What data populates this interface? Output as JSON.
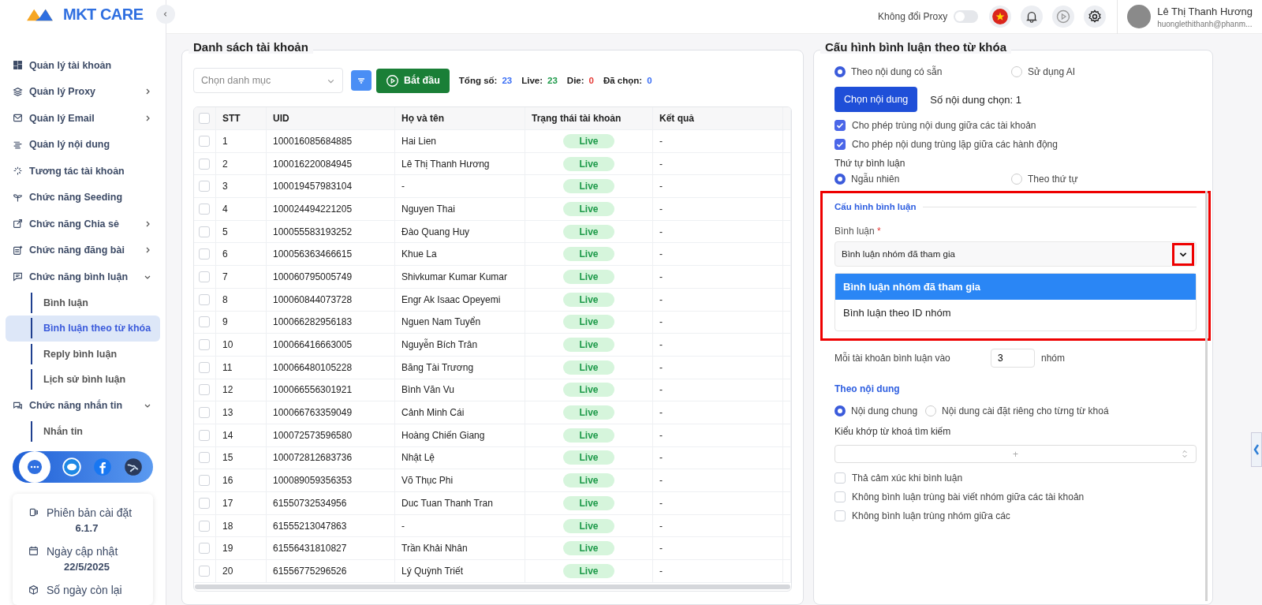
{
  "brand": {
    "name": "MKT CARE"
  },
  "header": {
    "proxy_label": "Không đổi Proxy",
    "proxy_on": false,
    "user_name": "Lê Thị Thanh Hương",
    "user_email": "huonglethithanh@phanm..."
  },
  "sidebar": {
    "items": [
      {
        "label": "Quản lý tài khoản",
        "has_submenu": false
      },
      {
        "label": "Quản lý Proxy",
        "has_submenu": true,
        "expanded": false
      },
      {
        "label": "Quản lý Email",
        "has_submenu": true,
        "expanded": false
      },
      {
        "label": "Quản lý nội dung",
        "has_submenu": false
      },
      {
        "label": "Tương tác tài khoản",
        "has_submenu": false
      },
      {
        "label": "Chức năng Seeding",
        "has_submenu": false
      },
      {
        "label": "Chức năng Chia sẻ",
        "has_submenu": true,
        "expanded": false
      },
      {
        "label": "Chức năng đăng bài",
        "has_submenu": true,
        "expanded": false
      },
      {
        "label": "Chức năng bình luận",
        "has_submenu": true,
        "expanded": true,
        "children": [
          {
            "label": "Bình luận",
            "selected": false
          },
          {
            "label": "Bình luận theo từ khóa",
            "selected": true
          },
          {
            "label": "Reply bình luận",
            "selected": false
          },
          {
            "label": "Lịch sử bình luận",
            "selected": false
          }
        ]
      },
      {
        "label": "Chức năng nhắn tin",
        "has_submenu": true,
        "expanded": true,
        "children": [
          {
            "label": "Nhắn tin",
            "selected": false
          }
        ]
      }
    ],
    "info": [
      {
        "label": "Phiên bản cài đặt",
        "value": "6.1.7"
      },
      {
        "label": "Ngày cập nhật",
        "value": "22/5/2025"
      },
      {
        "label": "Số ngày còn lại"
      }
    ]
  },
  "accounts": {
    "title": "Danh sách tài khoản",
    "category_placeholder": "Chọn danh mục",
    "start_button": "Bắt đầu",
    "stats": [
      {
        "label": "Tổng số:",
        "value": "23",
        "color": "#3b6ff5"
      },
      {
        "label": "Live:",
        "value": "23",
        "color": "#1e9a4a"
      },
      {
        "label": "Die:",
        "value": "0",
        "color": "#e53935"
      },
      {
        "label": "Đã chọn:",
        "value": "0",
        "color": "#3b6ff5"
      }
    ],
    "all_checked": false,
    "columns": [
      "STT",
      "UID",
      "Họ và tên",
      "Trạng thái tài khoản",
      "Kết quả"
    ],
    "rows": [
      {
        "stt": "1",
        "uid": "100016085684885",
        "name": "Hai Lien",
        "status": "Live",
        "result": "-",
        "checked": false
      },
      {
        "stt": "2",
        "uid": "100016220084945",
        "name": "Lê Thị Thanh Hương",
        "status": "Live",
        "result": "-",
        "checked": false
      },
      {
        "stt": "3",
        "uid": "100019457983104",
        "name": "-",
        "status": "Live",
        "result": "-",
        "checked": false
      },
      {
        "stt": "4",
        "uid": "100024494221205",
        "name": "Nguyen Thai",
        "status": "Live",
        "result": "-",
        "checked": false
      },
      {
        "stt": "5",
        "uid": "100055583193252",
        "name": "Đào Quang Huy",
        "status": "Live",
        "result": "-",
        "checked": false
      },
      {
        "stt": "6",
        "uid": "100056363466615",
        "name": "Khue La",
        "status": "Live",
        "result": "-",
        "checked": false
      },
      {
        "stt": "7",
        "uid": "100060795005749",
        "name": "Shivkumar Kumar Kumar",
        "status": "Live",
        "result": "-",
        "checked": false
      },
      {
        "stt": "8",
        "uid": "100060844073728",
        "name": "Engr Ak Isaac Opeyemi",
        "status": "Live",
        "result": "-",
        "checked": false
      },
      {
        "stt": "9",
        "uid": "100066282956183",
        "name": "Nguen Nam Tuyển",
        "status": "Live",
        "result": "-",
        "checked": false
      },
      {
        "stt": "10",
        "uid": "100066416663005",
        "name": "Nguyễn Bích Trân",
        "status": "Live",
        "result": "-",
        "checked": false
      },
      {
        "stt": "11",
        "uid": "100066480105228",
        "name": "Băng Tài Trương",
        "status": "Live",
        "result": "-",
        "checked": false
      },
      {
        "stt": "12",
        "uid": "100066556301921",
        "name": "Bình Văn Vu",
        "status": "Live",
        "result": "-",
        "checked": false
      },
      {
        "stt": "13",
        "uid": "100066763359049",
        "name": "Cảnh Minh Cái",
        "status": "Live",
        "result": "-",
        "checked": false
      },
      {
        "stt": "14",
        "uid": "100072573596580",
        "name": "Hoàng Chiến Giang",
        "status": "Live",
        "result": "-",
        "checked": false
      },
      {
        "stt": "15",
        "uid": "100072812683736",
        "name": "Nhật Lệ",
        "status": "Live",
        "result": "-",
        "checked": false
      },
      {
        "stt": "16",
        "uid": "100089059356353",
        "name": "Võ Thục Phi",
        "status": "Live",
        "result": "-",
        "checked": false
      },
      {
        "stt": "17",
        "uid": "61550732534956",
        "name": "Duc Tuan Thanh Tran",
        "status": "Live",
        "result": "-",
        "checked": false
      },
      {
        "stt": "18",
        "uid": "61555213047863",
        "name": "-",
        "status": "Live",
        "result": "-",
        "checked": false
      },
      {
        "stt": "19",
        "uid": "61556431810827",
        "name": "Trần Khải Nhân",
        "status": "Live",
        "result": "-",
        "checked": false
      },
      {
        "stt": "20",
        "uid": "61556775296526",
        "name": "Lý Quỳnh Triết",
        "status": "Live",
        "result": "-",
        "checked": false
      }
    ]
  },
  "config": {
    "title": "Cấu hình bình luận theo từ khóa",
    "source_options": [
      {
        "label": "Theo nội dung có sẵn",
        "selected": true
      },
      {
        "label": "Sử dụng AI",
        "selected": false
      }
    ],
    "choose_button": "Chọn nội dung",
    "chosen_count": "Số nội dung chọn: 1",
    "allow_options": [
      {
        "label": "Cho phép trùng nội dung giữa các tài khoản",
        "checked": true
      },
      {
        "label": "Cho phép nội dung trùng lặp giữa các hành động",
        "checked": true
      }
    ],
    "order_label": "Thứ tự bình luận",
    "order_options": [
      {
        "label": "Ngẫu nhiên",
        "selected": true
      },
      {
        "label": "Theo thứ tự",
        "selected": false
      }
    ],
    "section_title": "Cấu hình bình luận",
    "comment_label": "Bình luận",
    "required_mark": "*",
    "comment_value": "Bình luận nhóm đã tham gia",
    "dropdown_open": true,
    "dropdown_options": [
      {
        "label": "Bình luận nhóm đã tham gia",
        "selected": true
      },
      {
        "label": "Bình luận theo ID nhóm",
        "selected": false
      }
    ],
    "per_account_label": "Mỗi tài khoản bình luận vào",
    "per_account_value": "3",
    "per_account_unit": "nhóm",
    "content_title": "Theo nội dung",
    "content_options": [
      {
        "label": "Nội dung chung",
        "selected": true
      },
      {
        "label": "Nội dung cài đặt riêng cho từng từ khoá",
        "selected": false
      }
    ],
    "match_label": "Kiểu khớp từ khoá tìm kiếm",
    "match_value": "+",
    "extra_options": [
      {
        "label": "Thả cảm xúc khi bình luận",
        "checked": false
      },
      {
        "label": "Không bình luận trùng bài viết nhóm giữa các tài khoản",
        "checked": false
      },
      {
        "label": "Không bình luận trùng nhóm giữa các",
        "checked": false
      }
    ]
  }
}
